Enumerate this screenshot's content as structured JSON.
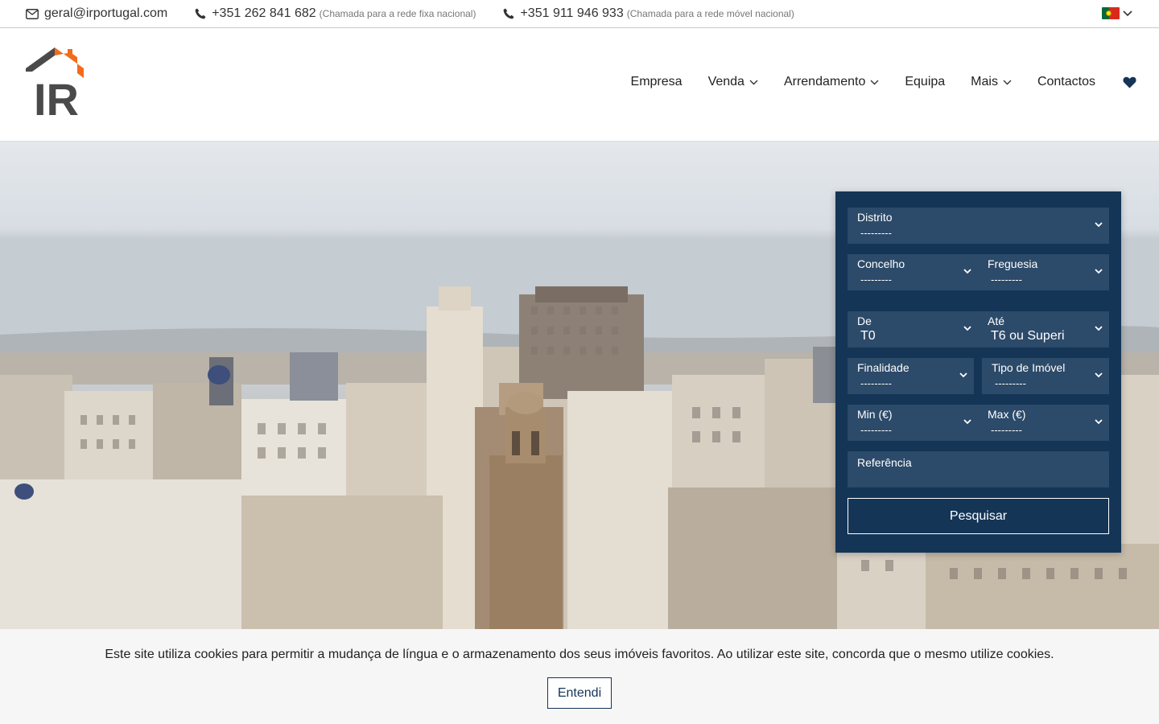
{
  "topbar": {
    "email": "geral@irportugal.com",
    "phone_fixed": "+351 262 841 682",
    "phone_fixed_note": "(Chamada para a rede fixa nacional)",
    "phone_mobile": "+351 911 946 933",
    "phone_mobile_note": "(Chamada para a rede móvel nacional)",
    "language_icon": "portugal-flag-icon"
  },
  "logo": {
    "text": "IR",
    "accent": "#f26b1d"
  },
  "nav": {
    "items": [
      {
        "label": "Empresa",
        "dropdown": false
      },
      {
        "label": "Venda",
        "dropdown": true
      },
      {
        "label": "Arrendamento",
        "dropdown": true
      },
      {
        "label": "Equipa",
        "dropdown": false
      },
      {
        "label": "Mais",
        "dropdown": true
      },
      {
        "label": "Contactos",
        "dropdown": false
      }
    ],
    "favorites_icon": "heart-icon"
  },
  "search": {
    "distrito": {
      "label": "Distrito",
      "value": "---------"
    },
    "concelho": {
      "label": "Concelho",
      "value": "---------"
    },
    "freguesia": {
      "label": "Freguesia",
      "value": "---------"
    },
    "de": {
      "label": "De",
      "value": "T0"
    },
    "ate": {
      "label": "Até",
      "value": "T6 ou Superi"
    },
    "finalidade": {
      "label": "Finalidade",
      "value": "---------"
    },
    "tipo": {
      "label": "Tipo de Imóvel",
      "value": "---------"
    },
    "min": {
      "label": "Min (€)",
      "value": "---------"
    },
    "max": {
      "label": "Max (€)",
      "value": "---------"
    },
    "referencia": {
      "label": "Referência",
      "value": ""
    },
    "submit_label": "Pesquisar"
  },
  "cookie": {
    "message": "Este site utiliza cookies para permitir a mudança de língua e o armazenamento dos seus imóveis favoritos. Ao utilizar este site, concorda que o mesmo utilize cookies.",
    "accept_label": "Entendi"
  },
  "colors": {
    "panel": "#143556",
    "field": "#2c4a69",
    "accent_orange": "#f26b1d",
    "logo_gray": "#4a4a4a"
  }
}
